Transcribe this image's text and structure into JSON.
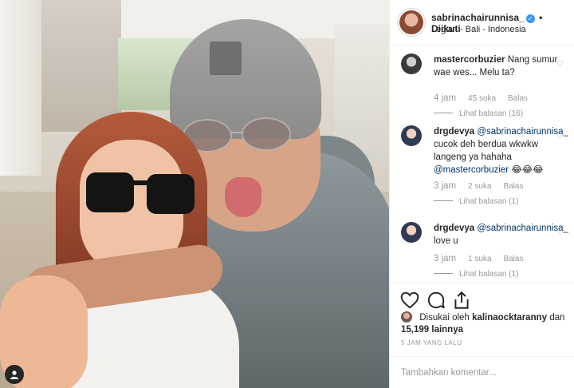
{
  "post": {
    "username": "sabrinachairunnisa_",
    "follow_separator": "•",
    "follow_label": "Diikuti",
    "location": "Legian - Bali - Indonesia"
  },
  "comments": [
    {
      "user": "mastercorbuzier",
      "text": "Nang sumur wae wes... Melu ta?",
      "mention": "",
      "emoji": "",
      "time": "4 jam",
      "likes": "45 suka",
      "reply": "Balas",
      "view_replies": "Lihat balasan (16)"
    },
    {
      "user": "drgdevya",
      "mention": "@sabrinachairunnisa_",
      "text": "cucok deh berdua wkwkw langeng ya hahaha",
      "mention2": "@mastercorbuzier",
      "emoji": "😂😂😂",
      "time": "3 jam",
      "likes": "2 suka",
      "reply": "Balas",
      "view_replies": "Lihat balasan (1)"
    },
    {
      "user": "drgdevya",
      "mention": "@sabrinachairunnisa_",
      "text": "love u",
      "time": "3 jam",
      "likes": "1 suka",
      "reply": "Balas",
      "view_replies": "Lihat balasan (1)"
    }
  ],
  "actions": {
    "liked_by_prefix": "Disukai oleh",
    "liked_by_user": "kalinaocktaranny",
    "liked_by_and": "dan",
    "liked_by_count": "15,199 lainnya",
    "timestamp": "5 JAM YANG LALU",
    "add_comment_placeholder": "Tambahkan komentar..."
  },
  "icons": {
    "like": "heart-icon",
    "comment": "comment-icon",
    "share": "share-icon",
    "bookmark": "bookmark-icon",
    "profile": "user-icon",
    "verified": "verified-badge-icon"
  },
  "colors": {
    "link": "#003569",
    "verified": "#3897f0",
    "muted": "#999999",
    "text": "#262626"
  }
}
